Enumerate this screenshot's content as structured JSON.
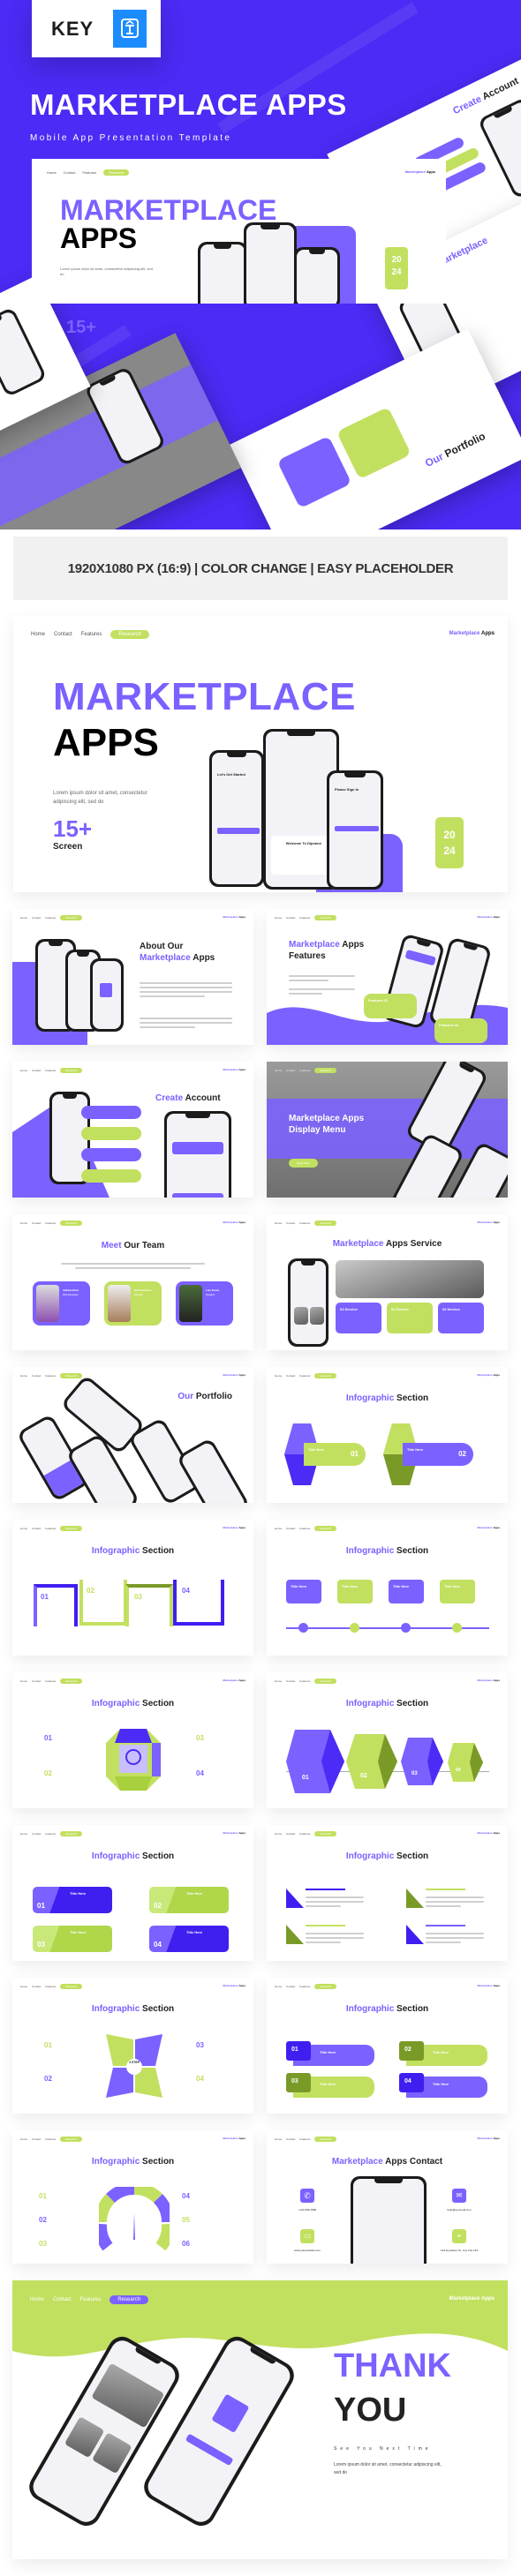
{
  "banner": {
    "badge_label": "KEY",
    "badge_icon": "keynote-icon",
    "title": "MARKETPLACE APPS",
    "subtitle": "Mobile App Presentation Template"
  },
  "nav": {
    "items": [
      "Home",
      "Contact",
      "Features"
    ],
    "active": "Research",
    "brand_primary": "Marketplace",
    "brand_secondary": "Apps"
  },
  "hero": {
    "title_line1": "MARKETPLACE",
    "title_line2": "APPS",
    "description": "Lorem ipsum dolor sit amet, consectetur adipiscing elit, sed do",
    "stat_value": "15+",
    "stat_label": "Screen",
    "year_top": "20",
    "year_bottom": "24",
    "phone_left_heading": "Let's Get Started",
    "phone_center_heading": "Welcome To Dipstore",
    "phone_right_heading": "Please Sign In"
  },
  "features_strip": "1920X1080 PX (16:9) | COLOR CHANGE | EASY PLACEHOLDER",
  "slides": {
    "about": {
      "title_a": "About Our",
      "title_hl": "Marketplace",
      "title_b": "Apps"
    },
    "features": {
      "title_hl": "Marketplace",
      "title_a": "Apps",
      "title_b": "Features",
      "card1": "Features 01",
      "card2": "Features 02"
    },
    "create": {
      "title_hl": "Create",
      "title_b": "Account"
    },
    "display": {
      "title_line1": "Marketplace Apps",
      "title_line2": "Display Menu",
      "button": "Read More"
    },
    "team": {
      "title_hl": "Meet",
      "title_b": "Our Team",
      "members": [
        {
          "name": "Jullieta Elise",
          "role": "Web Developer"
        },
        {
          "name": "Ela Francisca",
          "role": "Manager"
        },
        {
          "name": "Lars Paolo",
          "role": "Designer"
        }
      ]
    },
    "service": {
      "title_hl": "Marketplace",
      "title_b": "Apps Service",
      "cards": [
        "03 Service",
        "01 Service",
        "02 Service"
      ]
    },
    "portfolio": {
      "title_hl": "Our",
      "title_b": "Portfolio"
    },
    "info_title_hl": "Infographic",
    "info_title_b": "Section",
    "title_here": "Title Here",
    "info_numbers": [
      "01",
      "02",
      "03",
      "04",
      "05",
      "06"
    ],
    "step_label": "4 STEP",
    "contact": {
      "title_hl": "Marketplace",
      "title_b": "Apps Contact",
      "phone": "+123-456-7890",
      "email": "hello@yourmail.com",
      "website": "www.yourwebsite.com",
      "address": "123 Anywhere St., Any City 123"
    }
  },
  "thankyou": {
    "line1": "THANK",
    "line2": "YOU",
    "tagline": "See You Next Time",
    "description": "Lorem ipsum dolor sit amet, consectetur adipiscing elit, sed do"
  },
  "colors": {
    "primary": "#7b61ff",
    "deep": "#3f1ff0",
    "accent": "#c2e05f",
    "banner": "#4b2bf5"
  }
}
